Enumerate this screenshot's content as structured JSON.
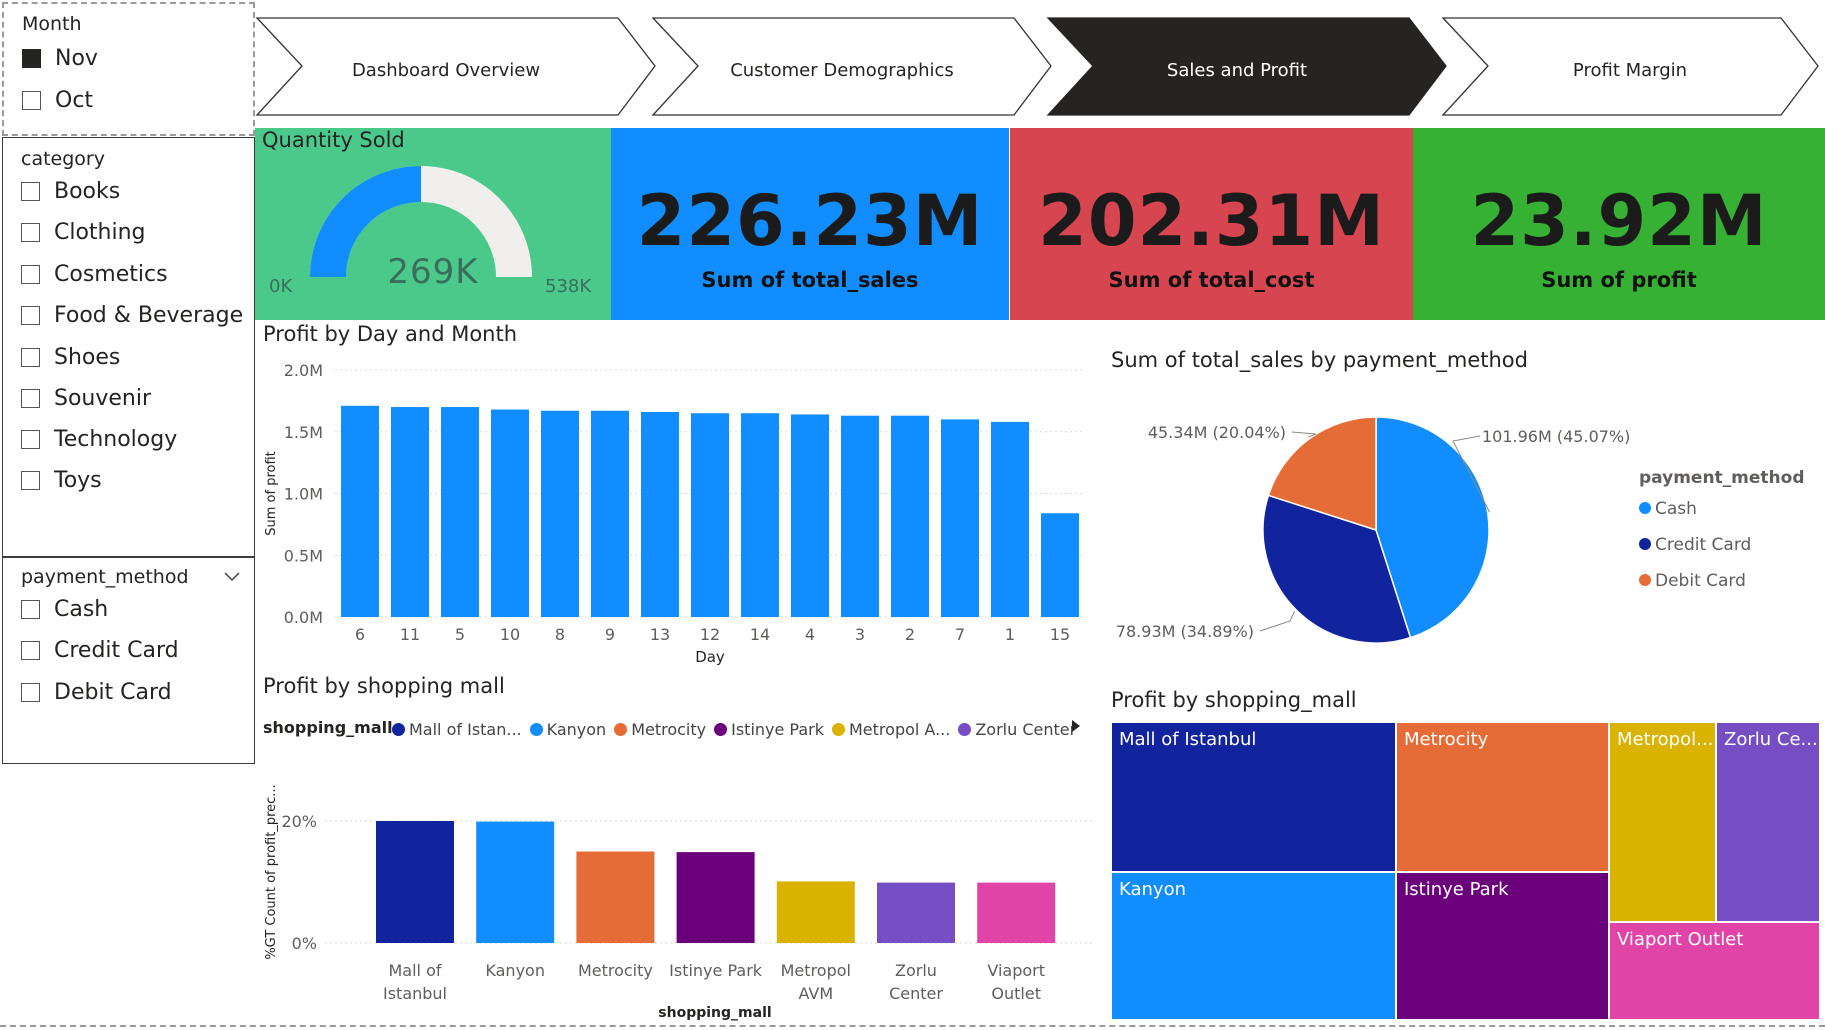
{
  "slicers": {
    "month": {
      "title": "Month",
      "options": [
        {
          "label": "Nov",
          "checked": true
        },
        {
          "label": "Oct",
          "checked": false
        }
      ]
    },
    "category": {
      "title": "category",
      "options": [
        {
          "label": "Books"
        },
        {
          "label": "Clothing"
        },
        {
          "label": "Cosmetics"
        },
        {
          "label": "Food & Beverage"
        },
        {
          "label": "Shoes"
        },
        {
          "label": "Souvenir"
        },
        {
          "label": "Technology"
        },
        {
          "label": "Toys"
        }
      ]
    },
    "payment": {
      "title": "payment_method",
      "options": [
        {
          "label": "Cash"
        },
        {
          "label": "Credit Card"
        },
        {
          "label": "Debit Card"
        }
      ]
    }
  },
  "nav": {
    "tabs": [
      {
        "label": "Dashboard Overview",
        "active": false
      },
      {
        "label": "Customer Demographics",
        "active": false
      },
      {
        "label": "Sales and Profit",
        "active": true
      },
      {
        "label": "Profit Margin",
        "active": false
      }
    ]
  },
  "gauge": {
    "title": "Quantity Sold",
    "value": "269K",
    "min": "0K",
    "max": "538K",
    "fraction": 0.5,
    "bg": "#4ac98b",
    "fill": "#118dff",
    "track": "#f1efed"
  },
  "kpis": [
    {
      "value": "226.23M",
      "label": "Sum of total_sales",
      "bg": "#118dff"
    },
    {
      "value": "202.31M",
      "label": "Sum of total_cost",
      "bg": "#d64550"
    },
    {
      "value": "23.92M",
      "label": "Sum of profit",
      "bg": "#36b134"
    }
  ],
  "profit_by_day": {
    "title": "Profit by Day and Month",
    "chart_data": {
      "type": "bar",
      "categories": [
        "6",
        "11",
        "5",
        "10",
        "8",
        "9",
        "13",
        "12",
        "14",
        "4",
        "3",
        "2",
        "7",
        "1",
        "15"
      ],
      "values": [
        1.71,
        1.7,
        1.7,
        1.68,
        1.67,
        1.67,
        1.66,
        1.65,
        1.65,
        1.64,
        1.63,
        1.63,
        1.6,
        1.58,
        0.84
      ],
      "xlabel": "Day",
      "ylabel": "Sum of profit",
      "yticks": [
        "0.0M",
        "0.5M",
        "1.0M",
        "1.5M",
        "2.0M"
      ],
      "ylim": [
        0,
        2.0
      ],
      "color": "#118dff"
    }
  },
  "payment_pie": {
    "title": "Sum of total_sales by payment_method",
    "legend_title": "payment_method",
    "chart_data": {
      "type": "pie",
      "slices": [
        {
          "name": "Cash",
          "value": 101.96,
          "label": "101.96M (45.07%)",
          "color": "#118dff"
        },
        {
          "name": "Credit Card",
          "value": 78.93,
          "label": "78.93M (34.89%)",
          "color": "#12239e"
        },
        {
          "name": "Debit Card",
          "value": 45.34,
          "label": "45.34M (20.04%)",
          "color": "#e66c37"
        }
      ]
    }
  },
  "mall_bar": {
    "title": "Profit by shopping mall",
    "legend_title": "shopping_mall",
    "legend": [
      {
        "label": "Mall of Istan...",
        "color": "#12239e"
      },
      {
        "label": "Kanyon",
        "color": "#118dff"
      },
      {
        "label": "Metrocity",
        "color": "#e66c37"
      },
      {
        "label": "Istinye Park",
        "color": "#6b007b"
      },
      {
        "label": "Metropol A...",
        "color": "#d9b300"
      },
      {
        "label": "Zorlu Center",
        "color": "#744ec2"
      }
    ],
    "chart_data": {
      "type": "bar",
      "categories": [
        [
          "Mall of",
          "Istanbul"
        ],
        [
          "Kanyon"
        ],
        [
          "Metrocity"
        ],
        [
          "Istinye Park"
        ],
        [
          "Metropol",
          "AVM"
        ],
        [
          "Zorlu",
          "Center"
        ],
        [
          "Viaport",
          "Outlet"
        ]
      ],
      "values": [
        20.0,
        19.9,
        15.0,
        14.9,
        10.1,
        9.9,
        9.9
      ],
      "colors": [
        "#12239e",
        "#118dff",
        "#e66c37",
        "#6b007b",
        "#d9b300",
        "#744ec2",
        "#e044a7"
      ],
      "xlabel": "shopping_mall",
      "ylabel": "%GT Count of profit_prec...",
      "yticks": [
        "0%",
        "20%"
      ],
      "ylim": [
        0,
        25
      ]
    }
  },
  "treemap": {
    "title": "Profit by shopping_mall",
    "tiles": [
      {
        "label": "Mall of Istanbul",
        "color": "#12239e"
      },
      {
        "label": "Metrocity",
        "color": "#e66c37"
      },
      {
        "label": "Metropol...",
        "color": "#d9b300"
      },
      {
        "label": "Zorlu Ce...",
        "color": "#744ec2"
      },
      {
        "label": "Kanyon",
        "color": "#118dff"
      },
      {
        "label": "Istinye Park",
        "color": "#6b007b"
      },
      {
        "label": "Viaport Outlet",
        "color": "#e044a7"
      }
    ]
  }
}
